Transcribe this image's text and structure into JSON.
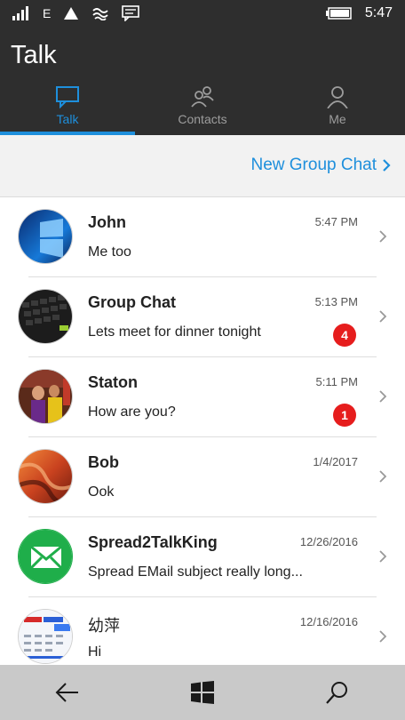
{
  "status_bar": {
    "network_letter": "E",
    "time": "5:47",
    "icons": [
      "signal-icon",
      "network-type-icon",
      "wifi-icon",
      "sync-icon",
      "message-icon",
      "battery-icon"
    ]
  },
  "app": {
    "title": "Talk"
  },
  "tabs": [
    {
      "label": "Talk",
      "icon": "chat-bubble-icon",
      "active": true
    },
    {
      "label": "Contacts",
      "icon": "contacts-icon",
      "active": false
    },
    {
      "label": "Me",
      "icon": "person-icon",
      "active": false
    }
  ],
  "new_group": {
    "label": "New Group Chat"
  },
  "conversations": [
    {
      "name": "John",
      "time": "5:47 PM",
      "preview": "Me too",
      "badge": null
    },
    {
      "name": "Group Chat",
      "time": "5:13 PM",
      "preview": "Lets meet for dinner tonight",
      "badge": "4"
    },
    {
      "name": "Staton",
      "time": "5:11 PM",
      "preview": "How are you?",
      "badge": "1"
    },
    {
      "name": "Bob",
      "time": "1/4/2017",
      "preview": "Ook",
      "badge": null
    },
    {
      "name": "Spread2TalkKing",
      "time": "12/26/2016",
      "preview": "Spread EMail subject really long...",
      "badge": null
    },
    {
      "name": "幼萍",
      "time": "12/16/2016",
      "preview": "Hi",
      "badge": null
    }
  ],
  "colors": {
    "accent": "#1e8fdc",
    "header_bg": "#2e2e2e",
    "badge": "#e61d1d",
    "nav_bg": "#c9c9c9"
  }
}
